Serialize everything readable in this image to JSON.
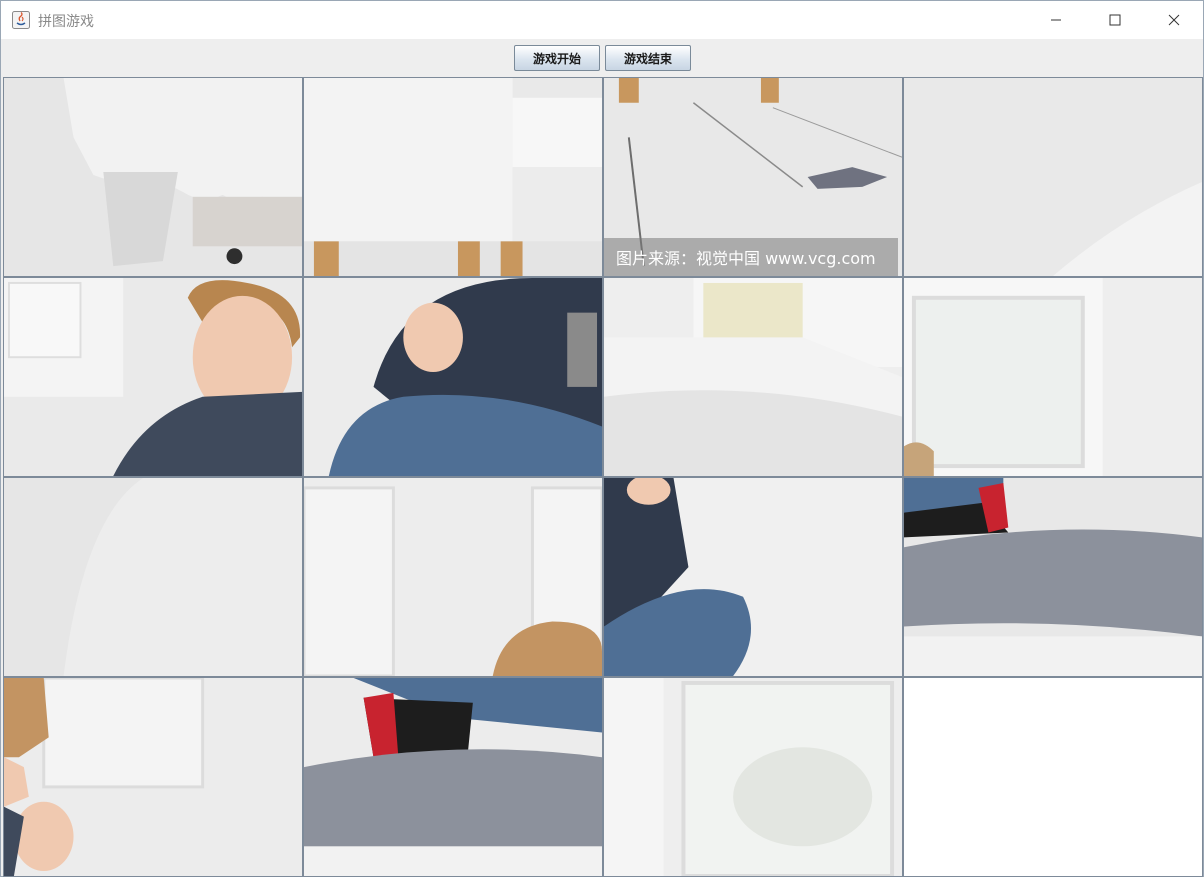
{
  "window": {
    "title": "拼图游戏",
    "controls": {
      "minimize": "minimize-icon",
      "maximize": "maximize-icon",
      "close": "close-icon"
    }
  },
  "toolbar": {
    "start_label": "游戏开始",
    "end_label": "游戏结束"
  },
  "board": {
    "rows": 4,
    "cols": 4,
    "watermark": "图片来源：视觉中国 www.vcg.com",
    "empty_position": "row 4, column 4"
  },
  "colors": {
    "title_bar": "#ffffff",
    "toolbar": "#eeeeee",
    "grid_line": "#7d8a99",
    "empty_tile": "#ffffff"
  }
}
